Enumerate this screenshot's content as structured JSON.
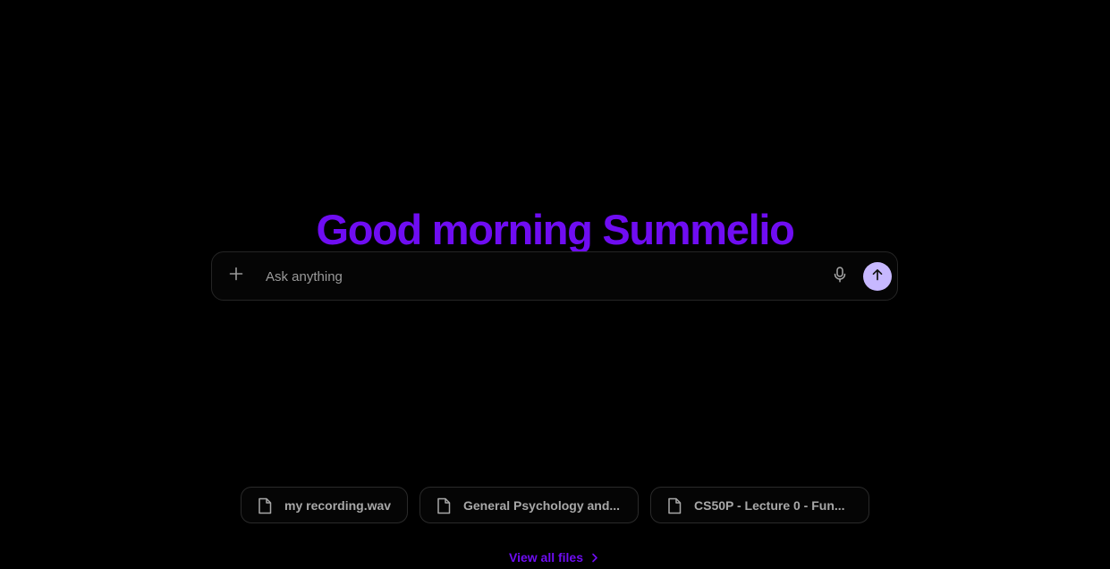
{
  "greeting": {
    "text": "Good morning Summelio",
    "color": "#6f0df2"
  },
  "composer": {
    "placeholder": "Ask anything",
    "value": "",
    "attach_icon": "plus-icon",
    "mic_icon": "microphone-icon",
    "send_icon": "arrow-up-icon",
    "send_button_color": "#c7b8ff"
  },
  "recent_files": [
    {
      "name": "my recording.wav",
      "icon": "file-icon"
    },
    {
      "name": "General Psychology and...",
      "icon": "file-icon"
    },
    {
      "name": "CS50P - Lecture 0 - Fun...",
      "icon": "file-icon"
    }
  ],
  "view_all": {
    "label": "View all files",
    "icon": "chevron-right-icon"
  }
}
